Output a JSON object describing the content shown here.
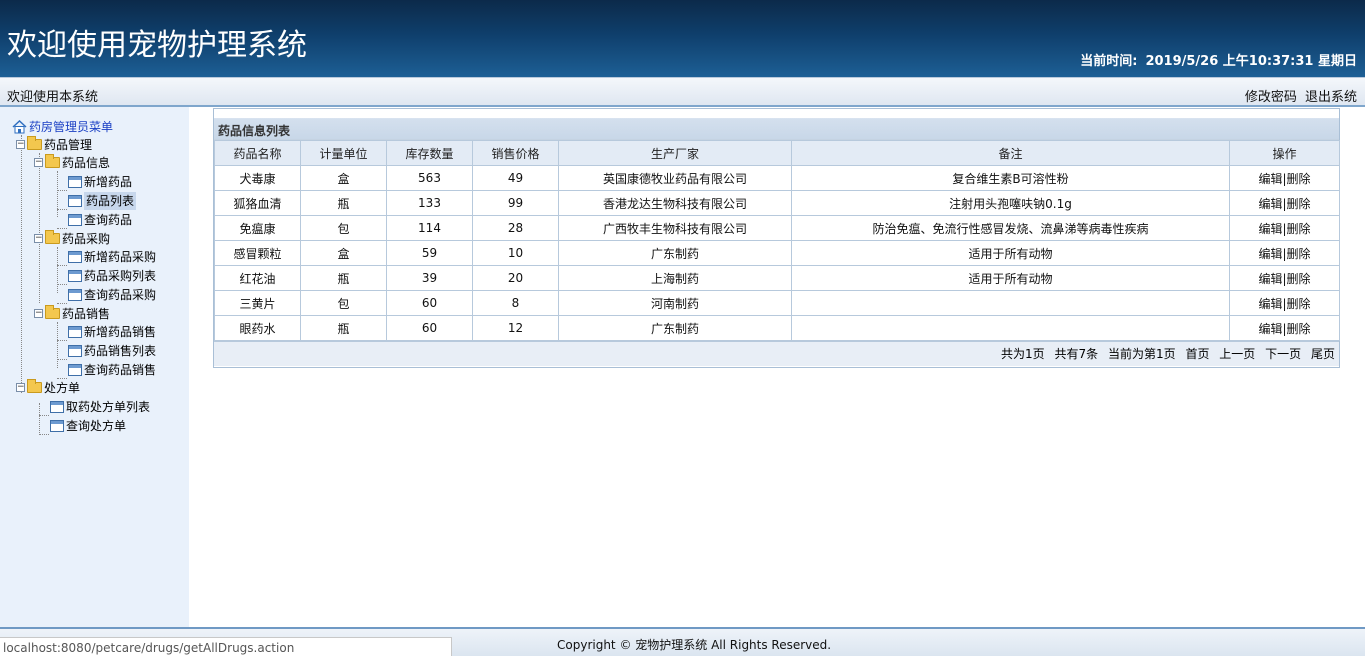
{
  "header": {
    "title": "欢迎使用宠物护理系统",
    "time_label": "当前时间:",
    "time_value": "2019/5/26 上午10:37:31 星期日"
  },
  "welcome": {
    "text": "欢迎使用本系统",
    "change_password": "修改密码",
    "logout": "退出系统"
  },
  "sidebar": {
    "root": "药房管理员菜单",
    "groups": {
      "drug_mgmt": "药品管理",
      "drug_info": "药品信息",
      "drug_info_add": "新增药品",
      "drug_info_list": "药品列表",
      "drug_info_query": "查询药品",
      "drug_purchase": "药品采购",
      "drug_purchase_add": "新增药品采购",
      "drug_purchase_list": "药品采购列表",
      "drug_purchase_query": "查询药品采购",
      "drug_sales": "药品销售",
      "drug_sales_add": "新增药品销售",
      "drug_sales_list": "药品销售列表",
      "drug_sales_query": "查询药品销售",
      "prescription": "处方单",
      "prescription_list": "取药处方单列表",
      "prescription_query": "查询处方单"
    }
  },
  "panel": {
    "title": "药品信息列表",
    "columns": [
      "药品名称",
      "计量单位",
      "库存数量",
      "销售价格",
      "生产厂家",
      "备注",
      "操作"
    ],
    "rows": [
      {
        "name": "犬毒康",
        "unit": "盒",
        "stock": "563",
        "price": "49",
        "maker": "英国康德牧业药品有限公司",
        "note": "复合维生素B可溶性粉"
      },
      {
        "name": "狐狢血清",
        "unit": "瓶",
        "stock": "133",
        "price": "99",
        "maker": "香港龙达生物科技有限公司",
        "note": "注射用头孢噻呋钠0.1g"
      },
      {
        "name": "免瘟康",
        "unit": "包",
        "stock": "114",
        "price": "28",
        "maker": "广西牧丰生物科技有限公司",
        "note": "防治免瘟、免流行性感冒发烧、流鼻涕等病毒性疾病"
      },
      {
        "name": "感冒颗粒",
        "unit": "盒",
        "stock": "59",
        "price": "10",
        "maker": "广东制药",
        "note": "适用于所有动物"
      },
      {
        "name": "红花油",
        "unit": "瓶",
        "stock": "39",
        "price": "20",
        "maker": "上海制药",
        "note": "适用于所有动物"
      },
      {
        "name": "三黄片",
        "unit": "包",
        "stock": "60",
        "price": "8",
        "maker": "河南制药",
        "note": ""
      },
      {
        "name": "眼药水",
        "unit": "瓶",
        "stock": "60",
        "price": "12",
        "maker": "广东制药",
        "note": ""
      }
    ],
    "edit_label": "编辑",
    "sep": "|",
    "delete_label": "删除",
    "pager": {
      "total_pages": "共为1页",
      "total_items": "共有7条",
      "current": "当前为第1页",
      "first": "首页",
      "prev": "上一页",
      "next": "下一页",
      "last": "尾页"
    }
  },
  "footer": {
    "status_url": "localhost:8080/petcare/drugs/getAllDrugs.action",
    "copyright": "Copyright © 宠物护理系统 All Rights Reserved."
  },
  "colors": {
    "banner": "#0f3f6c",
    "sidebar_bg": "#e9f1fb",
    "grid_border": "#b7c9dc"
  }
}
